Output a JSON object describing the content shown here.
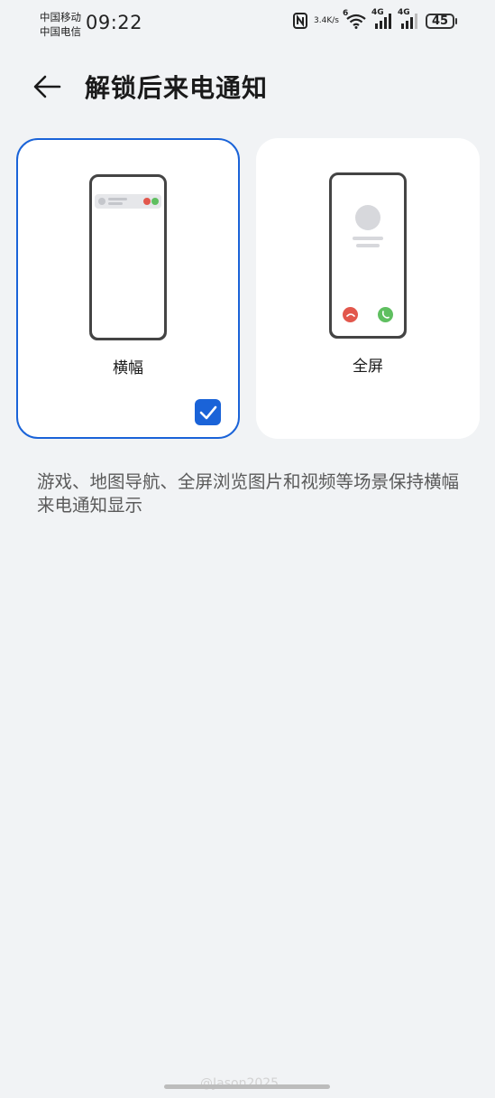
{
  "status_bar": {
    "carrier1": "中国移动",
    "carrier2": "中国电信",
    "time": "09:22",
    "speed_top": "3.4",
    "speed_bottom": "K/s",
    "wifi_badge": "6",
    "sim1": "4G",
    "sim2": "4G",
    "battery": "45"
  },
  "header": {
    "title": "解锁后来电通知",
    "back_icon": "arrow-left-icon"
  },
  "options": [
    {
      "label": "横幅",
      "selected": true
    },
    {
      "label": "全屏",
      "selected": false
    }
  ],
  "description": "游戏、地图导航、全屏浏览图片和视频等场景保持横幅来电通知显示",
  "watermark": "@Jason2025",
  "colors": {
    "accent": "#1a63d8",
    "background": "#f1f3f5",
    "decline": "#e2574c",
    "accept": "#5fbf60"
  }
}
